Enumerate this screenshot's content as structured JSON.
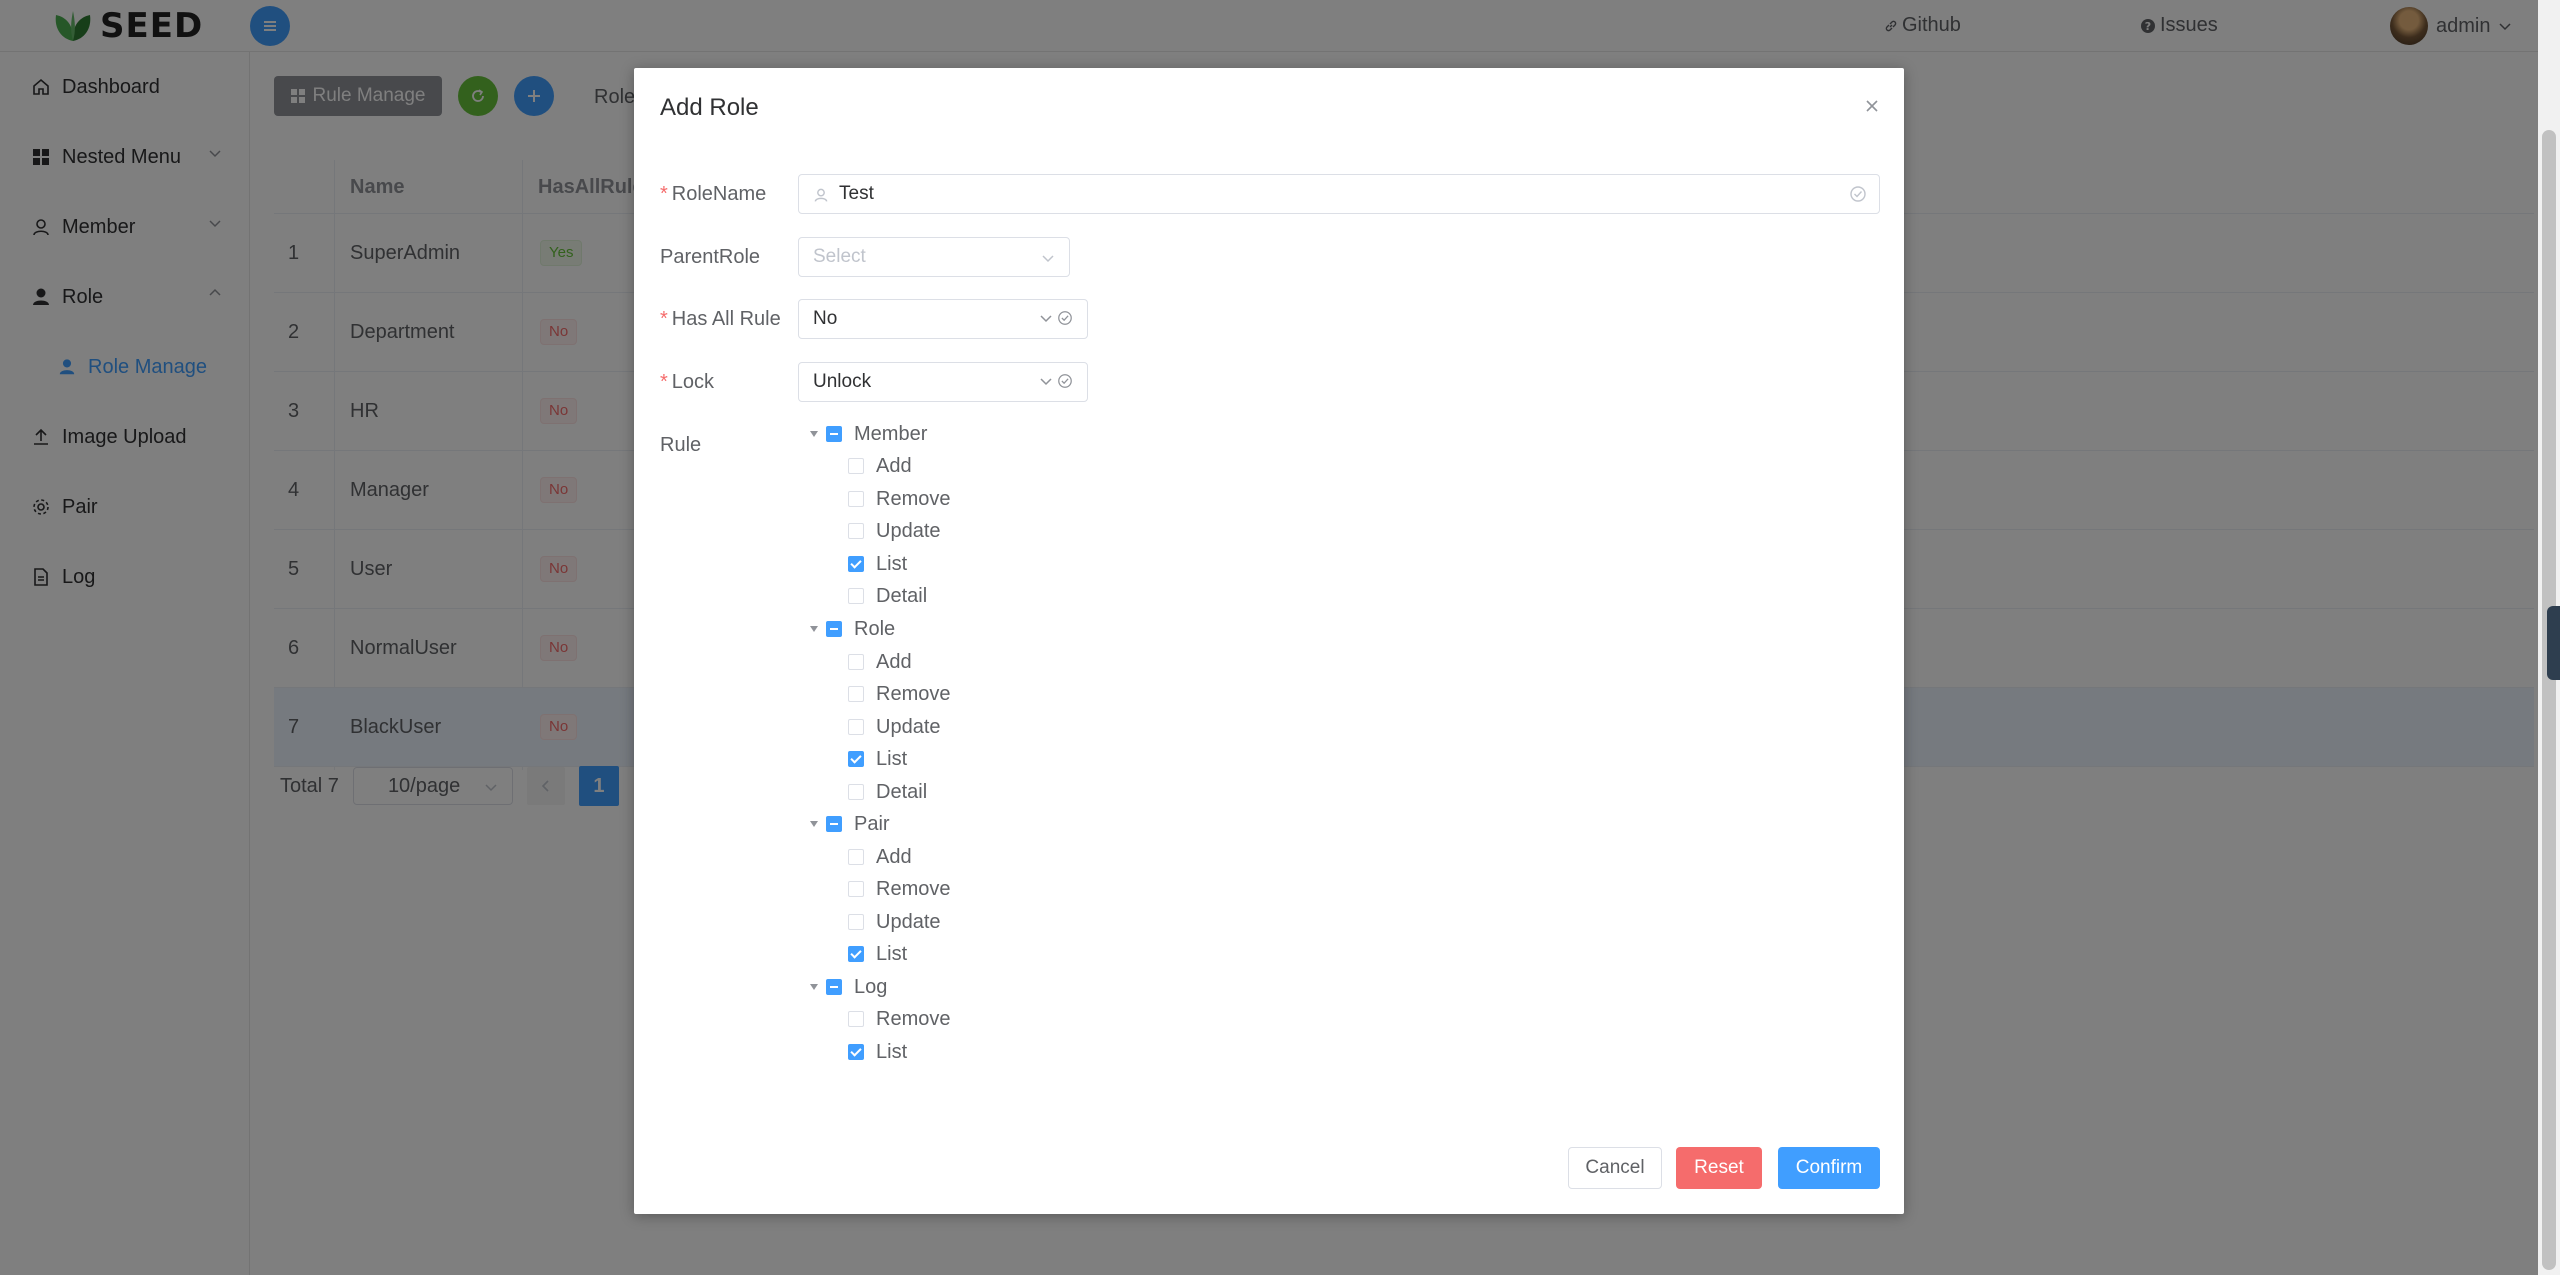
{
  "app": {
    "logo_text": "SEED",
    "github_label": "Github",
    "issues_label": "Issues",
    "user_name": "admin"
  },
  "sidebar": {
    "items": [
      {
        "label": "Dashboard"
      },
      {
        "label": "Nested Menu"
      },
      {
        "label": "Member"
      },
      {
        "label": "Role"
      },
      {
        "label": "Role Manage"
      },
      {
        "label": "Image Upload"
      },
      {
        "label": "Pair"
      },
      {
        "label": "Log"
      }
    ]
  },
  "toolbar": {
    "rule_manage_label": "Rule Manage",
    "role_filter_label": "Role"
  },
  "table": {
    "headers": [
      "Name",
      "HasAllRule"
    ],
    "rows": [
      {
        "index": "1",
        "name": "SuperAdmin",
        "has_all": "Yes"
      },
      {
        "index": "2",
        "name": "Department",
        "has_all": "No"
      },
      {
        "index": "3",
        "name": "HR",
        "has_all": "No"
      },
      {
        "index": "4",
        "name": "Manager",
        "has_all": "No"
      },
      {
        "index": "5",
        "name": "User",
        "has_all": "No"
      },
      {
        "index": "6",
        "name": "NormalUser",
        "has_all": "No"
      },
      {
        "index": "7",
        "name": "BlackUser",
        "has_all": "No"
      }
    ]
  },
  "pagination": {
    "total_label": "Total 7",
    "page_size": "10/page",
    "current_page": "1"
  },
  "dialog": {
    "title": "Add Role",
    "fields": {
      "role_name": {
        "label": "RoleName",
        "value": "Test"
      },
      "parent_role": {
        "label": "ParentRole",
        "placeholder": "Select"
      },
      "has_all_rule": {
        "label": "Has All Rule",
        "value": "No"
      },
      "lock": {
        "label": "Lock",
        "value": "Unlock"
      },
      "rule": {
        "label": "Rule"
      }
    },
    "tree": [
      {
        "label": "Member",
        "children": [
          {
            "label": "Add",
            "checked": false
          },
          {
            "label": "Remove",
            "checked": false
          },
          {
            "label": "Update",
            "checked": false
          },
          {
            "label": "List",
            "checked": true
          },
          {
            "label": "Detail",
            "checked": false
          }
        ]
      },
      {
        "label": "Role",
        "children": [
          {
            "label": "Add",
            "checked": false
          },
          {
            "label": "Remove",
            "checked": false
          },
          {
            "label": "Update",
            "checked": false
          },
          {
            "label": "List",
            "checked": true
          },
          {
            "label": "Detail",
            "checked": false
          }
        ]
      },
      {
        "label": "Pair",
        "children": [
          {
            "label": "Add",
            "checked": false
          },
          {
            "label": "Remove",
            "checked": false
          },
          {
            "label": "Update",
            "checked": false
          },
          {
            "label": "List",
            "checked": true
          }
        ]
      },
      {
        "label": "Log",
        "children": [
          {
            "label": "Remove",
            "checked": false
          },
          {
            "label": "List",
            "checked": true
          }
        ]
      }
    ],
    "buttons": {
      "cancel": "Cancel",
      "reset": "Reset",
      "confirm": "Confirm"
    }
  },
  "colors": {
    "primary": "#409eff",
    "success": "#67c23a",
    "danger": "#f56c6c",
    "info": "#909399"
  }
}
